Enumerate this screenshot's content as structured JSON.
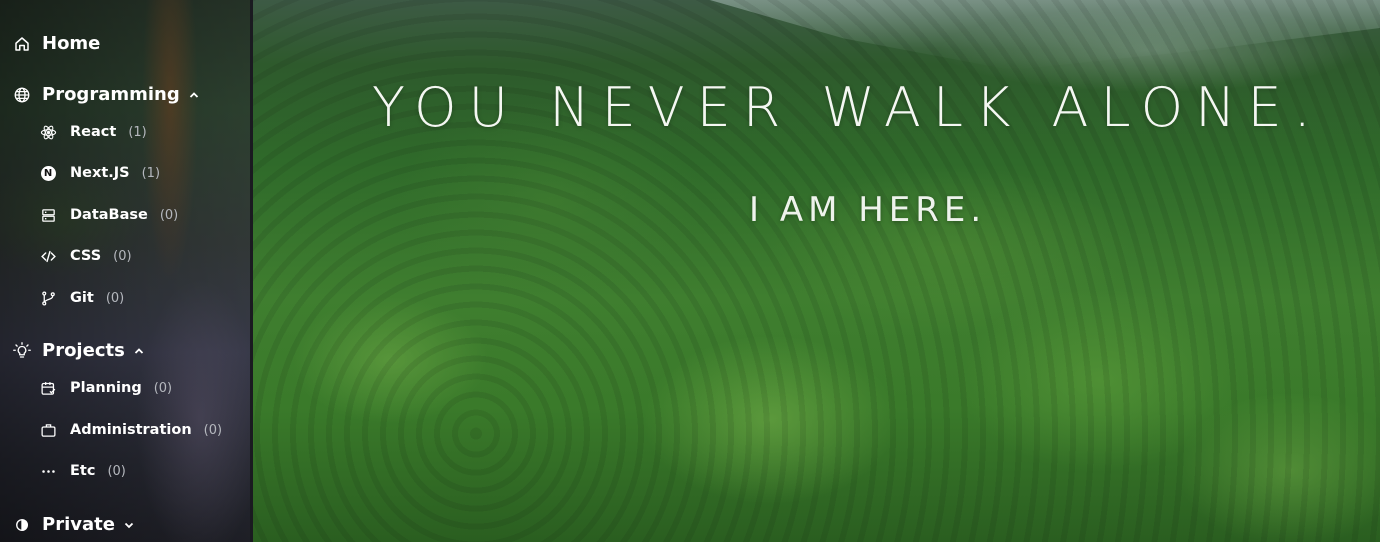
{
  "hero": {
    "title": "YOU NEVER WALK ALONE.",
    "subtitle": "I AM HERE."
  },
  "sidebar": {
    "home": {
      "label": "Home",
      "icon": "home-icon"
    },
    "programming": {
      "label": "Programming",
      "icon": "globe-icon",
      "expanded": true,
      "items": [
        {
          "label": "React",
          "count": "(1)",
          "icon": "atom-icon"
        },
        {
          "label": "Next.JS",
          "count": "(1)",
          "icon": "nextjs-icon"
        },
        {
          "label": "DataBase",
          "count": "(0)",
          "icon": "database-icon"
        },
        {
          "label": "CSS",
          "count": "(0)",
          "icon": "code-icon"
        },
        {
          "label": "Git",
          "count": "(0)",
          "icon": "git-branch-icon"
        }
      ]
    },
    "projects": {
      "label": "Projects",
      "icon": "lightbulb-icon",
      "expanded": true,
      "items": [
        {
          "label": "Planning",
          "count": "(0)",
          "icon": "calendar-icon"
        },
        {
          "label": "Administration",
          "count": "(0)",
          "icon": "briefcase-icon"
        },
        {
          "label": "Etc",
          "count": "(0)",
          "icon": "more-dots-icon"
        }
      ]
    },
    "private": {
      "label": "Private",
      "icon": "contrast-icon",
      "expanded": false
    }
  },
  "colors": {
    "text": "#ffffff",
    "count_text": "#b5b8be",
    "hero_text": "#f4f7f2"
  }
}
